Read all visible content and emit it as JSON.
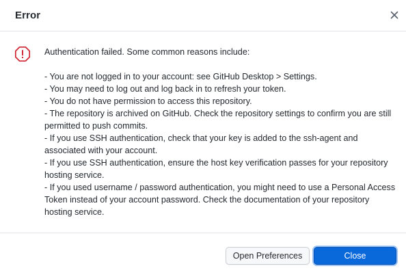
{
  "dialog": {
    "title": "Error",
    "close_icon": "close-icon",
    "error_icon": "error-octagon-icon",
    "accent_color": "#0a69da",
    "error_color": "#cf222e"
  },
  "message": {
    "intro": "Authentication failed. Some common reasons include:",
    "reasons": [
      "- You are not logged in to your account: see GitHub Desktop > Settings.",
      "- You may need to log out and log back in to refresh your token.",
      "- You do not have permission to access this repository.",
      "- The repository is archived on GitHub. Check the repository settings to confirm you are still permitted to push commits.",
      "- If you use SSH authentication, check that your key is added to the ssh-agent and associated with your account.",
      "- If you use SSH authentication, ensure the host key verification passes for your repository hosting service.",
      "- If you used username / password authentication, you might need to use a Personal Access Token instead of your account password. Check the documentation of your repository hosting service."
    ]
  },
  "buttons": {
    "open_preferences": "Open Preferences",
    "close": "Close"
  }
}
